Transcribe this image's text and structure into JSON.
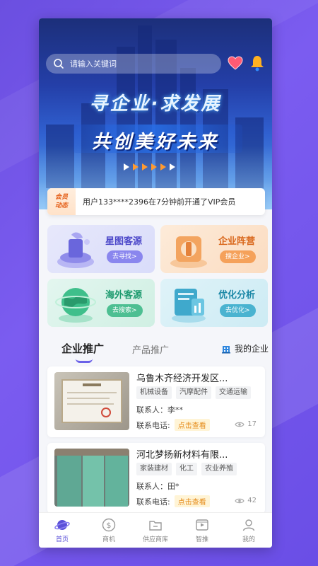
{
  "search": {
    "placeholder": "请输入关键词"
  },
  "banner": {
    "line1": "寻企业·求发展",
    "line2": "共创美好未来"
  },
  "notice": {
    "tag_line1": "会员",
    "tag_line2": "动态",
    "text": "用户133****2396在7分钟前开通了VIP会员"
  },
  "features": [
    {
      "title": "星图客源",
      "button": "去寻找>"
    },
    {
      "title": "企业阵营",
      "button": "搜企业>"
    },
    {
      "title": "海外客源",
      "button": "去搜索>"
    },
    {
      "title": "优化分析",
      "button": "去优化>"
    }
  ],
  "tabs": {
    "active": "企业推广",
    "inactive": "产品推广",
    "my_company": "我的企业"
  },
  "listings": [
    {
      "name": "乌鲁木齐经济开发区...",
      "tags": [
        "机械设备",
        "汽摩配件",
        "交通运输"
      ],
      "contact": "联系人：李**",
      "phone_label": "联系电话:",
      "phone_action": "点击查看",
      "views": "17"
    },
    {
      "name": "河北梦扬新材料有限...",
      "tags": [
        "家装建材",
        "化工",
        "农业养殖"
      ],
      "contact": "联系人：田*",
      "phone_label": "联系电话:",
      "phone_action": "点击查看",
      "views": "42"
    }
  ],
  "nav": [
    {
      "label": "首页",
      "icon": "planet-icon",
      "active": true
    },
    {
      "label": "商机",
      "icon": "dollar-coin-icon"
    },
    {
      "label": "供应商库",
      "icon": "folder-icon"
    },
    {
      "label": "智推",
      "icon": "video-icon"
    },
    {
      "label": "我的",
      "icon": "user-icon"
    }
  ],
  "colors": {
    "accent": "#6b62e8",
    "background": "#7b5cf0",
    "orange": "#e58b1a"
  }
}
